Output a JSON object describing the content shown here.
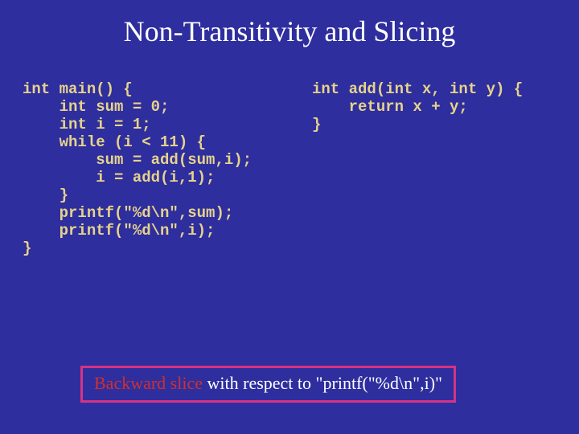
{
  "title": "Non-Transitivity and Slicing",
  "code": {
    "main": "int main() {\n    int sum = 0;\n    int i = 1;\n    while (i < 11) {\n        sum = add(sum,i);\n        i = add(i,1);\n    }\n    printf(\"%d\\n\",sum);\n    printf(\"%d\\n\",i);\n}",
    "add": "int add(int x, int y) {\n    return x + y;\n}"
  },
  "callout": {
    "prefix": "Backward slice",
    "suffix": " with respect to \"printf(\"%d\\n\",i)\""
  }
}
